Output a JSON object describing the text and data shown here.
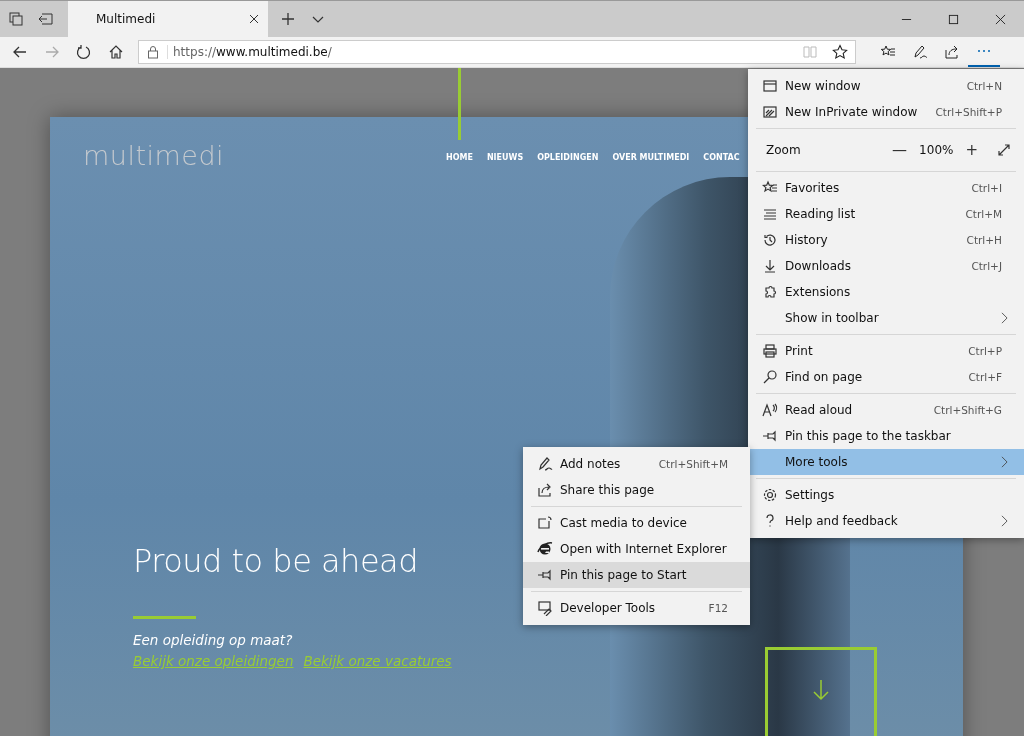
{
  "tab": {
    "title": "Multimedi",
    "selected": true
  },
  "address_bar": {
    "url_prefix": "https://",
    "url_host": "www.multimedi.be",
    "url_path": "/"
  },
  "site": {
    "logo": "multimedi",
    "nav": [
      {
        "label": "HOME"
      },
      {
        "label": "NIEUWS"
      },
      {
        "label": "OPLEIDINGEN"
      },
      {
        "label": "OVER MULTIMEDI"
      },
      {
        "label": "CONTAC"
      }
    ],
    "heading": "Proud to be ahead",
    "subheading": "Een opleiding op maat?",
    "links": [
      "Bekijk onze opleidingen",
      "Bekijk onze vacatures"
    ]
  },
  "menu": {
    "sections": [
      [
        {
          "kind": "item",
          "label": "New window",
          "shortcut": "Ctrl+N",
          "selected": false
        },
        {
          "kind": "item",
          "label": "New InPrivate window",
          "shortcut": "Ctrl+Shift+P",
          "selected": false
        }
      ],
      [
        {
          "kind": "zoom",
          "label": "Zoom",
          "value": "100%",
          "minus": "—",
          "plus": "+"
        }
      ],
      [
        {
          "kind": "item",
          "label": "Favorites",
          "shortcut": "Ctrl+I",
          "selected": false
        },
        {
          "kind": "item",
          "label": "Reading list",
          "shortcut": "Ctrl+M",
          "selected": false
        },
        {
          "kind": "item",
          "label": "History",
          "shortcut": "Ctrl+H",
          "selected": false
        },
        {
          "kind": "item",
          "label": "Downloads",
          "shortcut": "Ctrl+J",
          "selected": false
        },
        {
          "kind": "item",
          "label": "Extensions",
          "selected": false
        },
        {
          "kind": "submenu",
          "label": "Show in toolbar",
          "selected": false
        }
      ],
      [
        {
          "kind": "item",
          "label": "Print",
          "shortcut": "Ctrl+P",
          "selected": false
        },
        {
          "kind": "item",
          "label": "Find on page",
          "shortcut": "Ctrl+F",
          "selected": false
        }
      ],
      [
        {
          "kind": "item",
          "label": "Read aloud",
          "shortcut": "Ctrl+Shift+G",
          "selected": false
        },
        {
          "kind": "item",
          "label": "Pin this page to the taskbar",
          "selected": false
        },
        {
          "kind": "submenu",
          "label": "More tools",
          "selected": true
        }
      ],
      [
        {
          "kind": "item",
          "label": "Settings",
          "selected": false
        },
        {
          "kind": "submenu",
          "label": "Help and feedback",
          "selected": false
        }
      ]
    ]
  },
  "submenu": {
    "sections": [
      [
        {
          "kind": "item",
          "label": "Add notes",
          "shortcut": "Ctrl+Shift+M",
          "selected": false
        },
        {
          "kind": "item",
          "label": "Share this page",
          "selected": false
        }
      ],
      [
        {
          "kind": "item",
          "label": "Cast media to device",
          "selected": false
        },
        {
          "kind": "item",
          "label": "Open with Internet Explorer",
          "selected": false
        },
        {
          "kind": "item",
          "label": "Pin this page to Start",
          "selected": true
        }
      ],
      [
        {
          "kind": "item",
          "label": "Developer Tools",
          "shortcut": "F12",
          "selected": false
        }
      ]
    ]
  }
}
